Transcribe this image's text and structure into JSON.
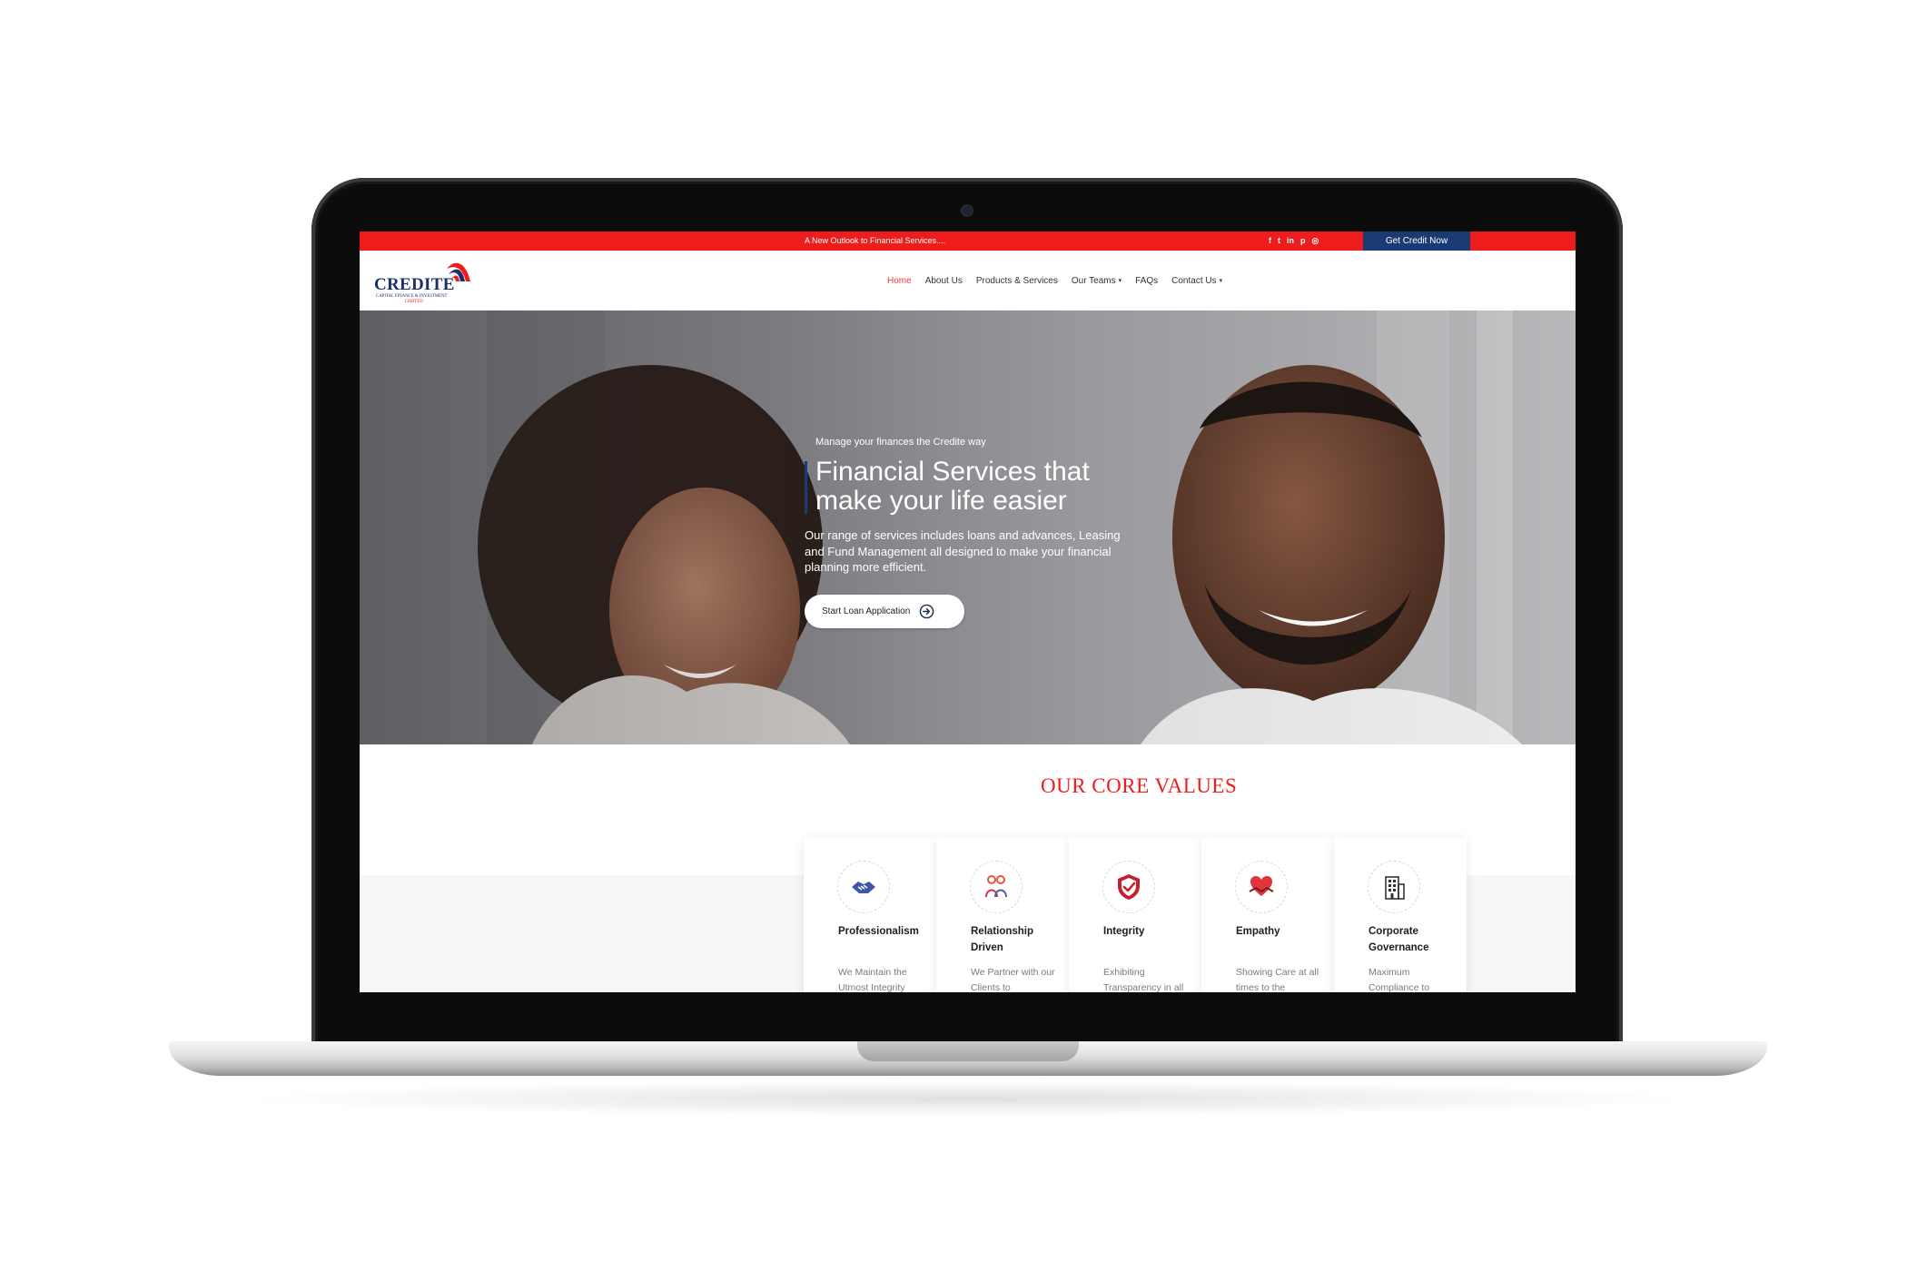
{
  "topbar": {
    "announcement": "A New Outlook to Financial Services....",
    "social": [
      {
        "icon": "facebook-icon",
        "glyph": "f"
      },
      {
        "icon": "twitter-icon",
        "glyph": "t"
      },
      {
        "icon": "linkedin-icon",
        "glyph": "in"
      },
      {
        "icon": "pinterest-icon",
        "glyph": "p"
      },
      {
        "icon": "instagram-icon",
        "glyph": "◎"
      }
    ],
    "cta_label": "Get Credit Now"
  },
  "logo": {
    "wordmark": "CREDITE",
    "subline": "CAPITAL FINANCE & INVESTMENT",
    "subline2": "LIMITED"
  },
  "nav": {
    "items": [
      {
        "label": "Home",
        "active": true
      },
      {
        "label": "About Us"
      },
      {
        "label": "Products & Services"
      },
      {
        "label": "Our Teams",
        "dropdown": true
      },
      {
        "label": "FAQs"
      },
      {
        "label": "Contact Us",
        "dropdown": true
      }
    ],
    "caret": "▾"
  },
  "hero": {
    "tagline": "Manage your finances the Credite way",
    "title": "Financial Services that make your life easier",
    "description": "Our range of services includes loans and advances, Leasing and Fund Management all designed to make your financial planning more efficient.",
    "cta_label": "Start Loan Application"
  },
  "core_values": {
    "title": "OUR CORE VALUES",
    "cards": [
      {
        "icon": "handshake-icon",
        "title": "Professionalism",
        "text": "We Maintain the Utmost Integrity"
      },
      {
        "icon": "people-icon",
        "title": "Relationship Driven",
        "text": "We Partner with our Clients to"
      },
      {
        "icon": "shield-check-icon",
        "title": "Integrity",
        "text": "Exhibiting Transparency in all"
      },
      {
        "icon": "heart-hands-icon",
        "title": "Empathy",
        "text": "Showing Care at all times to the"
      },
      {
        "icon": "building-icon",
        "title": "Corporate Governance",
        "text": "Maximum Compliance to"
      }
    ]
  },
  "colors": {
    "brand_red": "#ee1c1c",
    "brand_navy": "#1a3a73"
  }
}
